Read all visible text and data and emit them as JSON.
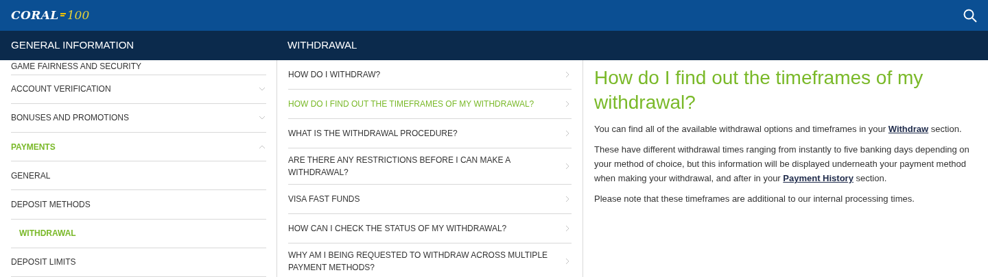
{
  "header": {
    "logo": {
      "brand": "CORAL",
      "badge": "100"
    }
  },
  "left_panel": {
    "title": "GENERAL INFORMATION",
    "items": [
      {
        "label": "GAME FAIRNESS AND SECURITY",
        "selected": false
      },
      {
        "label": "ACCOUNT VERIFICATION",
        "expanded": false,
        "selected": false
      },
      {
        "label": "BONUSES AND PROMOTIONS",
        "expanded": false,
        "selected": false
      },
      {
        "label": "PAYMENTS",
        "expanded": true,
        "selected": true,
        "children": [
          {
            "label": "GENERAL",
            "selected": false
          },
          {
            "label": "DEPOSIT METHODS",
            "selected": false
          },
          {
            "label": "WITHDRAWAL",
            "selected": true
          },
          {
            "label": "DEPOSIT LIMITS",
            "selected": false
          }
        ]
      }
    ]
  },
  "middle_panel": {
    "title": "WITHDRAWAL",
    "questions": [
      {
        "label": "HOW DO I WITHDRAW?",
        "selected": false
      },
      {
        "label": "HOW DO I FIND OUT THE TIMEFRAMES OF MY WITHDRAWAL?",
        "selected": true
      },
      {
        "label": "WHAT IS THE WITHDRAWAL PROCEDURE?",
        "selected": false
      },
      {
        "label": "ARE THERE ANY RESTRICTIONS BEFORE I CAN MAKE A WITHDRAWAL?",
        "selected": false
      },
      {
        "label": "VISA FAST FUNDS",
        "selected": false
      },
      {
        "label": "HOW CAN I CHECK THE STATUS OF MY WITHDRAWAL?",
        "selected": false
      },
      {
        "label": "WHY AM I BEING REQUESTED TO WITHDRAW ACROSS MULTIPLE PAYMENT METHODS?",
        "selected": false
      }
    ]
  },
  "article": {
    "title": "How do I find out the timeframes of my withdrawal?",
    "paragraphs": [
      {
        "before": "You can find all of the available withdrawal options and timeframes in your ",
        "link": "Withdraw",
        "after": " section."
      },
      {
        "before": "These have different withdrawal times ranging from instantly to five banking days depending on your method of choice, but this information will be displayed underneath your payment method when making your withdrawal, and after in your ",
        "link": "Payment History",
        "after": " section."
      },
      {
        "before": "Please note that these timeframes are additional to our internal processing times."
      }
    ]
  }
}
